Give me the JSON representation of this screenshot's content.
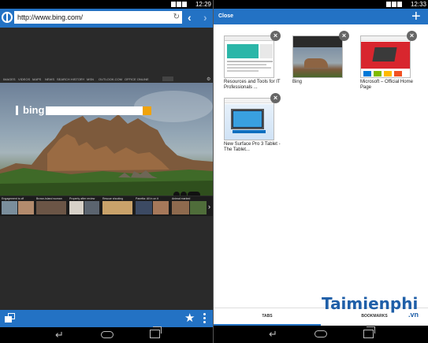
{
  "left_pane": {
    "status_bar": {
      "time": "12:29"
    },
    "address_bar": {
      "url": "http://www.bing.com/",
      "icons": [
        "globe-icon",
        "refresh-icon",
        "back-arrow-icon",
        "forward-arrow-icon"
      ]
    },
    "bing_page": {
      "logo": "bing",
      "logo_sub": "",
      "nav_links": [
        "IMAGES",
        "VIDEOS",
        "MAPS",
        "NEWS",
        "SEARCH HISTORY",
        "MSN",
        "OUTLOOK.COM",
        "OFFICE ONLINE"
      ],
      "news_captions": [
        "Engagement is off",
        "Brown-Island woman",
        "Property after review",
        "Rescue shooting",
        "Panetta: All in on it",
        "Animal marked"
      ],
      "footer_links": [
        "",
        "",
        "",
        "",
        "",
        "",
        ""
      ]
    },
    "bottom_bar": {
      "icons": [
        "tabs-icon",
        "star-icon",
        "more-icon"
      ]
    }
  },
  "right_pane": {
    "status_bar": {
      "time": "12:33"
    },
    "header": {
      "close_label": "Close",
      "add_icon": "plus-icon"
    },
    "tabs": [
      {
        "title": "Resources and Tools for IT Professionals ..."
      },
      {
        "title": "Bing"
      },
      {
        "title": "Microsoft – Official Home Page"
      },
      {
        "title": "New Surface Pro 3 Tablet - The Tablet..."
      }
    ],
    "bottom_tabs": {
      "tabs_label": "TABS",
      "bookmarks_label": "BOOKMARKS"
    },
    "watermark": {
      "brand": "Taimienphi",
      "suffix": ".vn"
    }
  },
  "colors": {
    "accent": "#2372c4",
    "bing_go": "#f0a30a",
    "ms_red": "#d8262e"
  }
}
